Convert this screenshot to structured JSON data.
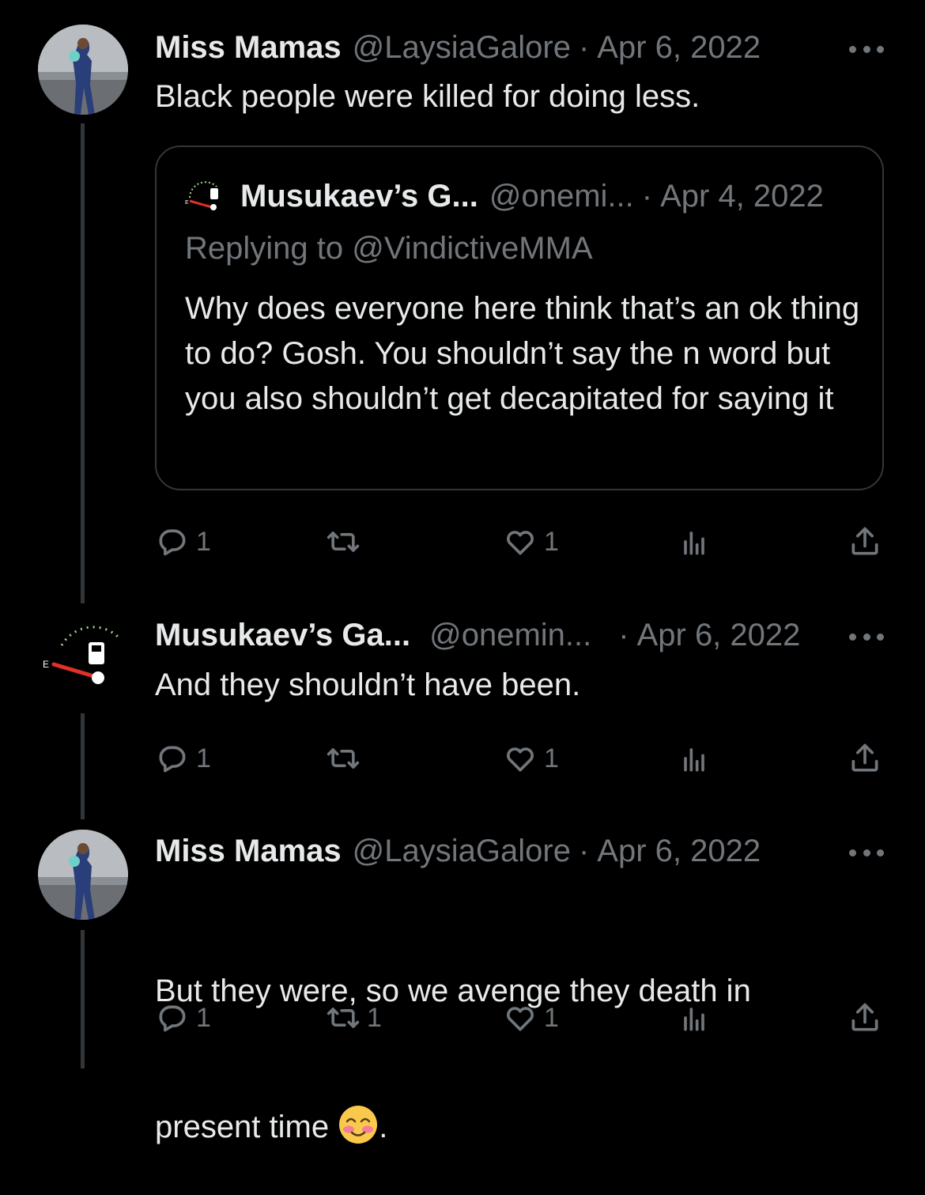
{
  "tweets": [
    {
      "name": "Miss Mamas",
      "handle": "@LaysiaGalore",
      "sep": "·",
      "date": "Apr 6, 2022",
      "text": "Black people were killed for doing less.",
      "quote": {
        "name": "Musukaev’s G...",
        "handle": "@onemi...",
        "sep": "·",
        "date": "Apr 4, 2022",
        "replying": "Replying to @VindictiveMMA",
        "text": "Why does everyone here think that’s an ok thing to do? Gosh. You shouldn’t say the n word but you also shouldn’t get decapitated for saying it"
      },
      "actions": {
        "replies": "1",
        "retweets": "",
        "likes": "1"
      }
    },
    {
      "name": "Musukaev’s Ga...",
      "handle": "@onemin...",
      "sep": "·",
      "date": "Apr 6, 2022",
      "text": "And they shouldn’t have been.",
      "actions": {
        "replies": "1",
        "retweets": "",
        "likes": "1"
      }
    },
    {
      "name": "Miss Mamas",
      "handle": "@LaysiaGalore",
      "sep": "·",
      "date": "Apr 6, 2022",
      "text_line1": "But they were, so we avenge they death in",
      "text_line2": "present time",
      "text_end": ".",
      "emoji": "smiling-face-blushing-emoji",
      "actions": {
        "replies": "1",
        "retweets": "1",
        "likes": "1"
      }
    }
  ],
  "icons": {
    "reply": "reply-icon",
    "retweet": "retweet-icon",
    "like": "heart-icon",
    "views": "views-icon",
    "share": "share-icon",
    "more": "more-icon"
  },
  "colors": {
    "bg": "#000000",
    "text": "#e7e9ea",
    "muted": "#71767b",
    "border": "#333639"
  }
}
